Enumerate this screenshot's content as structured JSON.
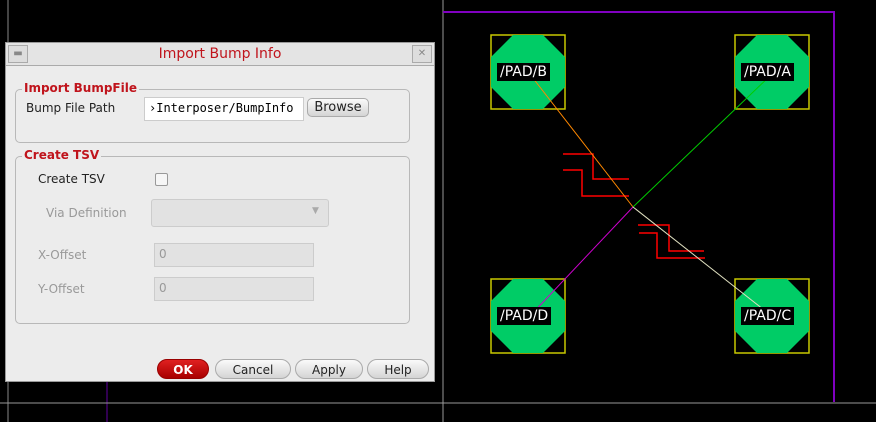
{
  "dialog": {
    "title": "Import Bump Info",
    "import_group": "Import BumpFile",
    "bump_path_label": "Bump File Path",
    "bump_path_value": "›Interposer/BumpInfo",
    "browse": "Browse",
    "tsv_group": "Create TSV",
    "create_tsv_label": "Create TSV",
    "create_tsv_checked": false,
    "via_label": "Via Definition",
    "via_value": "",
    "xoff_label": "X-Offset",
    "xoff_value": "0",
    "yoff_label": "Y-Offset",
    "yoff_value": "0",
    "ok": "OK",
    "cancel": "Cancel",
    "apply": "Apply",
    "help": "Help"
  },
  "layout_view": {
    "pads": [
      "/PAD/B",
      "/PAD/A",
      "/PAD/D",
      "/PAD/C"
    ],
    "colors": {
      "pad": "#00cc66",
      "pad_box": "#c8c800",
      "boundary": "#8000c0",
      "net_b": "#ff8800",
      "net_a": "#00cc00",
      "net_d": "#cc00cc",
      "net_c": "#e0e0c0",
      "wire": "#ff0000"
    }
  }
}
